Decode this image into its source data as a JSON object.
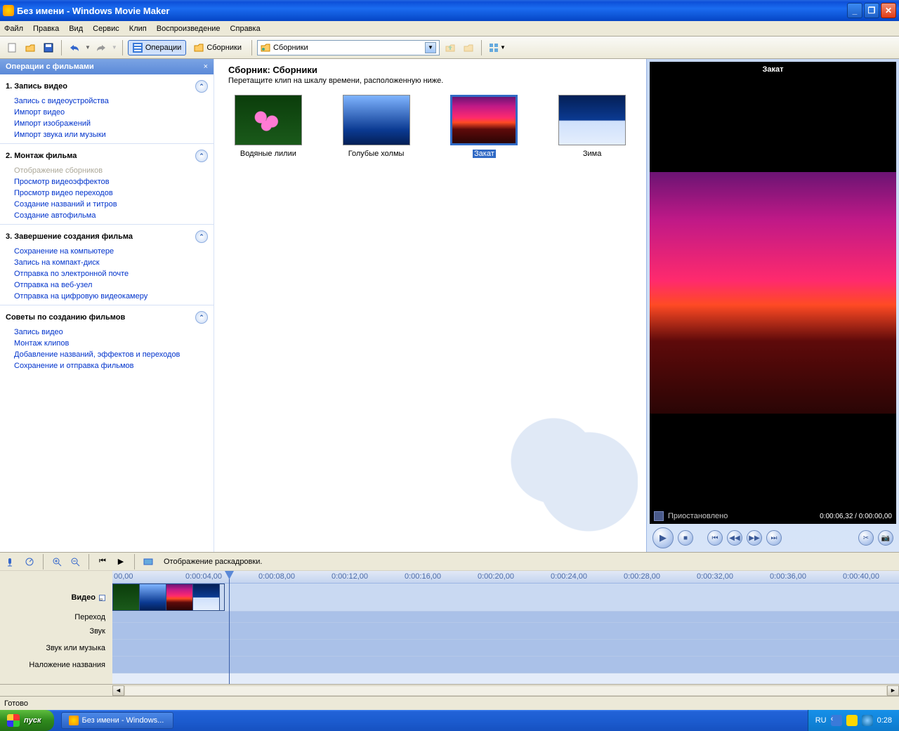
{
  "window": {
    "title": "Без имени - Windows Movie Maker"
  },
  "menus": [
    "Файл",
    "Правка",
    "Вид",
    "Сервис",
    "Клип",
    "Воспроизведение",
    "Справка"
  ],
  "toolbar": {
    "tasks_btn": "Операции",
    "collections_btn": "Сборники",
    "collection_dd": "Сборники"
  },
  "sidebar": {
    "header": "Операции с фильмами",
    "g1": {
      "title": "1. Запись видео",
      "items": [
        "Запись с видеоустройства",
        "Импорт видео",
        "Импорт изображений",
        "Импорт звука или музыки"
      ]
    },
    "g2": {
      "title": "2. Монтаж фильма",
      "disabled": "Отображение сборников",
      "items": [
        "Просмотр видеоэффектов",
        "Просмотр видео переходов",
        "Создание названий и титров",
        "Создание автофильма"
      ]
    },
    "g3": {
      "title": "3. Завершение создания фильма",
      "items": [
        "Сохранение на компьютере",
        "Запись на компакт-диск",
        "Отправка по электронной почте",
        "Отправка на веб-узел",
        "Отправка на цифровую видеокамеру"
      ]
    },
    "g4": {
      "title": "Советы по созданию фильмов",
      "items": [
        "Запись видео",
        "Монтаж клипов",
        "Добавление названий, эффектов и переходов",
        "Сохранение и отправка фильмов"
      ]
    }
  },
  "collection": {
    "title": "Сборник: Сборники",
    "hint": "Перетащите клип на шкалу времени, расположенную ниже.",
    "items": [
      "Водяные лилии",
      "Голубые холмы",
      "Закат",
      "Зима"
    ],
    "selected": "Закат"
  },
  "preview": {
    "title": "Закат",
    "status": "Приостановлено",
    "timecode": "0:00:06,32 / 0:00:00,00"
  },
  "timeline": {
    "storyboard_btn": "Отображение раскадровки.",
    "ruler": [
      "00,00",
      "0:00:04,00",
      "0:00:08,00",
      "0:00:12,00",
      "0:00:16,00",
      "0:00:20,00",
      "0:00:24,00",
      "0:00:28,00",
      "0:00:32,00",
      "0:00:36,00",
      "0:00:40,00"
    ],
    "tracks": {
      "video": "Видео",
      "transition": "Переход",
      "audio": "Звук",
      "audiomusic": "Звук или музыка",
      "titleoverlay": "Наложение названия"
    }
  },
  "statusbar": "Готово",
  "taskbar": {
    "start": "пуск",
    "app": "Без имени - Windows...",
    "lang": "RU",
    "clock": "0:28"
  }
}
